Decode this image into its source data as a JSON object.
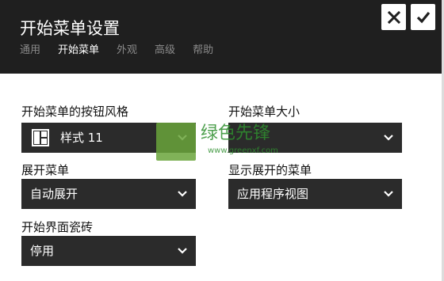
{
  "window": {
    "title": "开始菜单设置",
    "close_icon": "close-icon",
    "confirm_icon": "checkmark-icon"
  },
  "tabs": [
    {
      "label": "通用",
      "active": false
    },
    {
      "label": "开始菜单",
      "active": true
    },
    {
      "label": "外观",
      "active": false
    },
    {
      "label": "高级",
      "active": false
    },
    {
      "label": "帮助",
      "active": false
    }
  ],
  "settings": {
    "button_style": {
      "label": "开始菜单的按钮风格",
      "value": "样式 11",
      "icon": "start-button-style-icon"
    },
    "menu_size": {
      "label": "开始菜单大小",
      "value": ""
    },
    "expand_menu": {
      "label": "展开菜单",
      "value": "自动展开"
    },
    "show_expanded": {
      "label": "显示展开的菜单",
      "value": "应用程序视图"
    },
    "tiles": {
      "label": "开始界面瓷砖",
      "value": "停用"
    }
  },
  "watermark": {
    "brand": "绿色先锋",
    "url": "www.greenxf.com"
  },
  "colors": {
    "header_bg": "#1f1f1f",
    "dropdown_bg": "#2b2b2b",
    "tab_inactive": "#8a8a8a",
    "tab_active": "#ffffff"
  }
}
